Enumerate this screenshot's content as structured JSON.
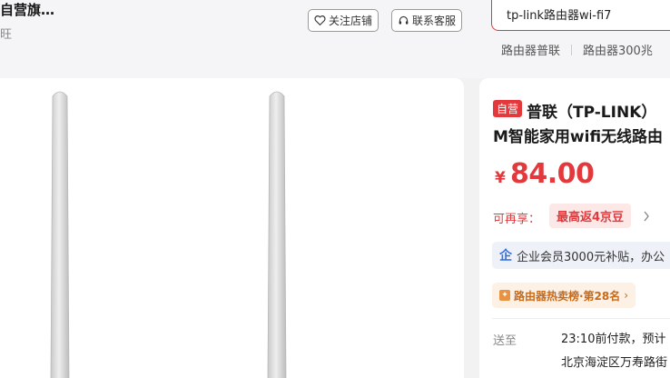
{
  "header": {
    "shop_name": "自营旗…",
    "shop_sub": "旺",
    "follow_label": "关注店铺",
    "service_label": "联系客服"
  },
  "search": {
    "value": "tp-link路由器wi-fi7",
    "hot_words": [
      "路由器普联",
      "路由器300兆"
    ]
  },
  "product": {
    "badge": "自营",
    "title_line1": "普联（TP-LINK）",
    "title_line2": "M智能家用wifi无线路由",
    "currency": "¥",
    "price": "84.00",
    "rebate_label": "可再享：",
    "rebate_tag": "最高返4京豆",
    "enterprise_text": "企业会员3000元补贴，办公",
    "enterprise_icon": "企",
    "rank_text": "路由器热卖榜·第28名",
    "ship_label": "送至",
    "ship_time": "23:10前付款，预计",
    "ship_addr": "北京海淀区万寿路街"
  },
  "colors": {
    "accent": "#e4393c",
    "rank": "#c76a1a",
    "enterprise_icon": "#2f6fe0"
  }
}
